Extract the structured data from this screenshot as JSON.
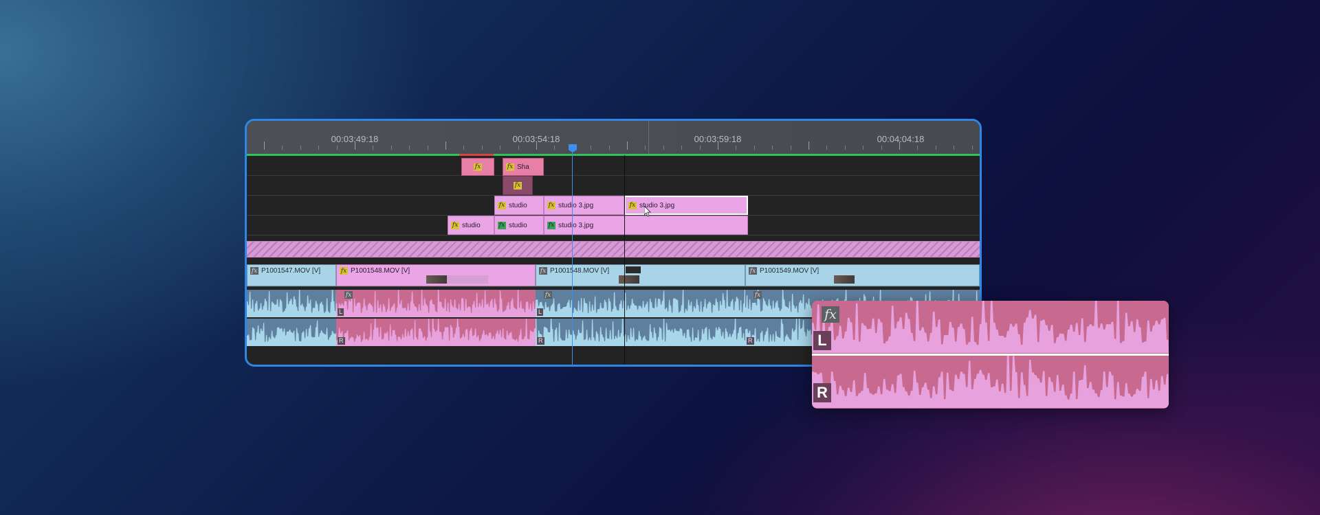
{
  "ruler": {
    "timecodes": [
      "00:03:49:18",
      "00:03:54:18",
      "00:03:59:18",
      "00:04:04:18"
    ]
  },
  "graphics_tracks": {
    "top_clips": [
      {
        "fx": "fx",
        "label": ""
      },
      {
        "fx": "fx",
        "label": "Sha"
      }
    ],
    "sub_clip": {
      "fx": "fx"
    },
    "row3_clips": [
      {
        "fx": "fx",
        "label": "studio"
      },
      {
        "fx": "fx",
        "label": "studio 3.jpg"
      },
      {
        "fx": "fx",
        "label": "studio 3.jpg"
      }
    ],
    "row4_clips": [
      {
        "fx": "fx",
        "label": "studio"
      },
      {
        "fx": "fx",
        "label": "studio"
      },
      {
        "fx": "fx",
        "label": "studio 3.jpg"
      }
    ]
  },
  "video_track": {
    "clips": [
      {
        "fx": "fx",
        "label": "P1001547.MOV [V]"
      },
      {
        "fx": "fx",
        "label": "P1001548.MOV [V]"
      },
      {
        "fx": "fx",
        "label": "P1001548.MOV [V]"
      },
      {
        "fx": "fx",
        "label": "P1001549.MOV [V]"
      }
    ]
  },
  "audio_track": {
    "fx_label": "fx",
    "left_channel": "L",
    "right_channel": "R"
  },
  "zoom": {
    "fx_label": "fx",
    "left_channel": "L",
    "right_channel": "R"
  },
  "colors": {
    "panel_border": "#2e86e6",
    "playhead": "#3d8ef0",
    "work_area": "#2fc15a",
    "audio_blue_bg": "#5f7f9e",
    "audio_blue_wave": "#a8d7ea",
    "audio_pink_bg": "#c86a8f",
    "audio_pink_wave": "#e7a2de"
  }
}
